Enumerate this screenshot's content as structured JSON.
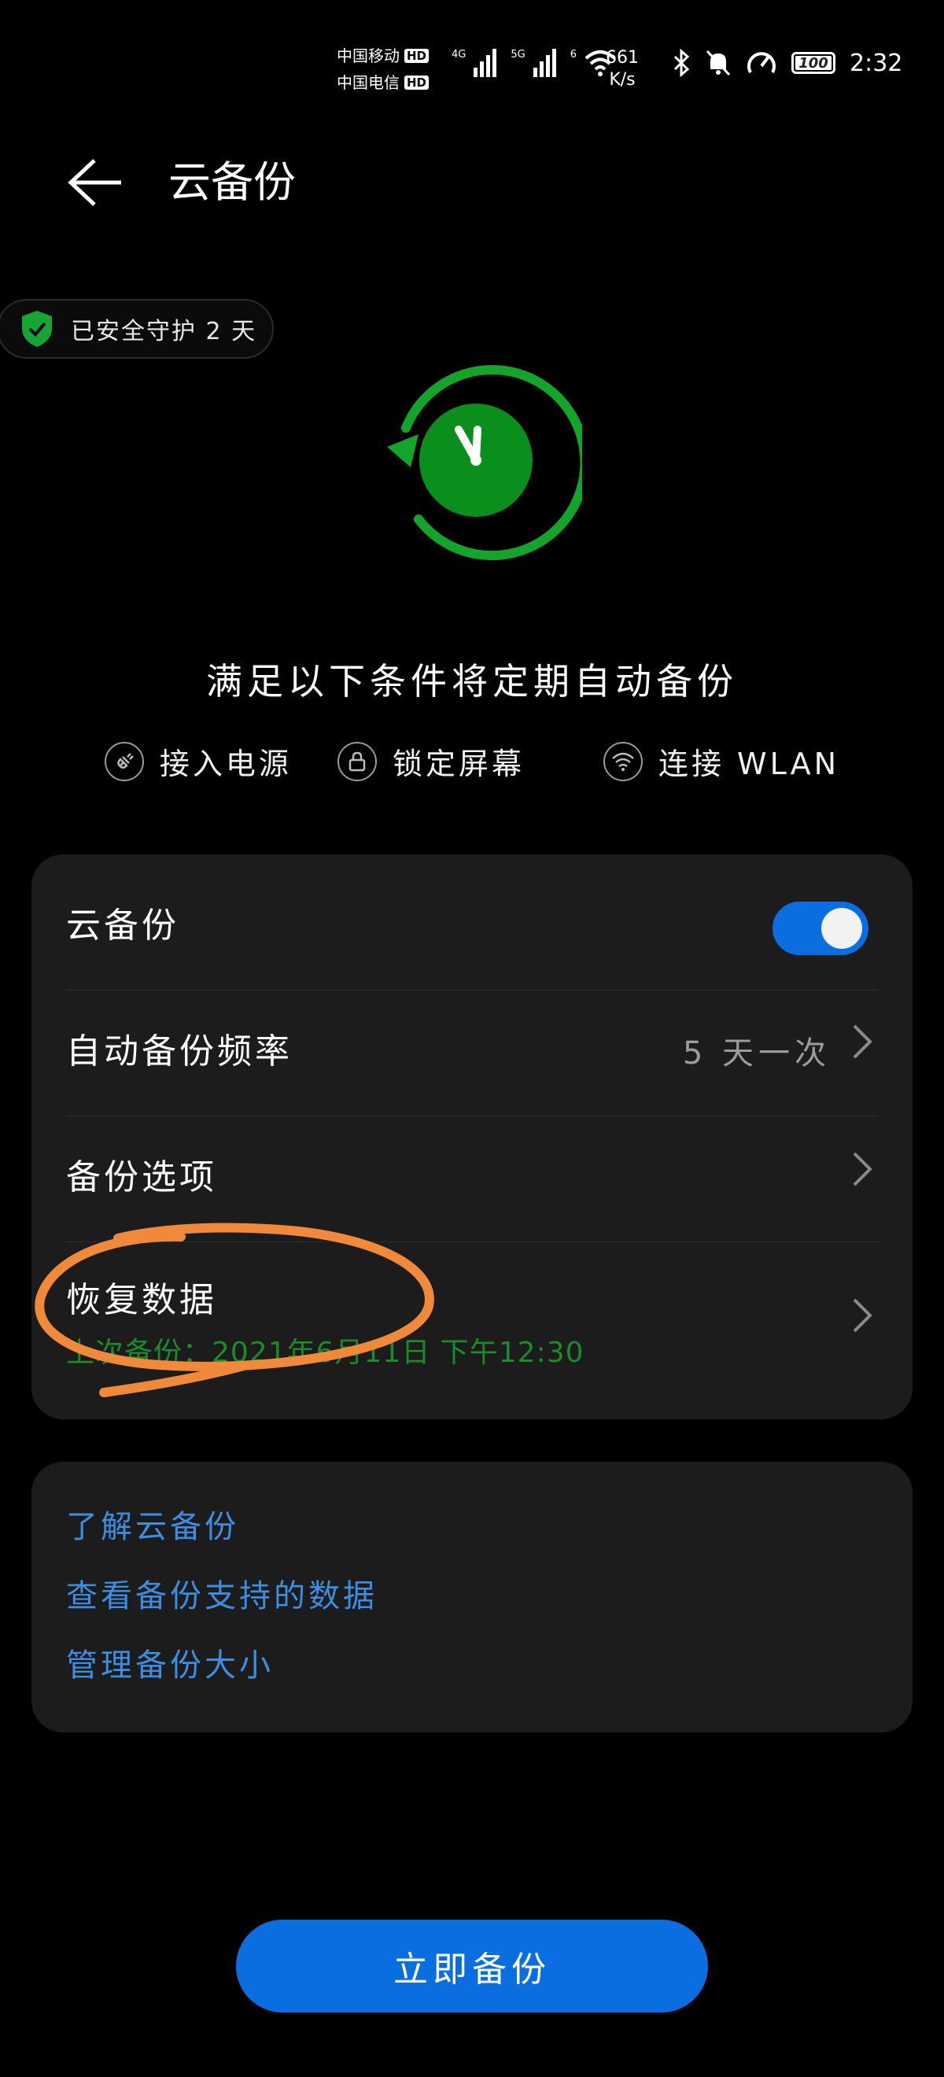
{
  "status_bar": {
    "carrier1": "中国移动",
    "carrier2": "中国电信",
    "hd_badge": "HD",
    "signal1_label": "4G",
    "signal2_label": "5G",
    "wifi_label": "6",
    "net_speed_value": "661",
    "net_speed_unit": "K/s",
    "battery_level": "100",
    "time": "2:32"
  },
  "header": {
    "title": "云备份"
  },
  "protection": {
    "text": "已安全守护 2 天"
  },
  "conditions": {
    "title": "满足以下条件将定期自动备份",
    "items": [
      "接入电源",
      "锁定屏幕",
      "连接 WLAN"
    ]
  },
  "settings": {
    "cloud_backup_label": "云备份",
    "cloud_backup_on": true,
    "frequency_label": "自动备份频率",
    "frequency_value": "5 天一次",
    "options_label": "备份选项",
    "restore_label": "恢复数据",
    "last_backup": "上次备份：2021年6月11日 下午12:30"
  },
  "links": [
    "了解云备份",
    "查看备份支持的数据",
    "管理备份大小"
  ],
  "primary_button": "立即备份",
  "colors": {
    "accent_blue": "#0a6ee0",
    "link_blue": "#3d8de0",
    "success_green": "#1a8a2a",
    "annotation_orange": "#f08a3a"
  }
}
